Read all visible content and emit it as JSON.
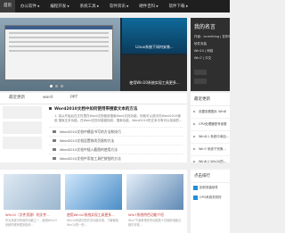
{
  "nav": {
    "home": "首页",
    "items": [
      {
        "label": "办公软件"
      },
      {
        "label": "编程开发"
      },
      {
        "label": "系统工具"
      },
      {
        "label": "软件资讯"
      },
      {
        "label": "硬件百科"
      },
      {
        "label": "软件下载"
      }
    ]
  },
  "slider": {
    "slide_b_caption": "Linux系统下如何安装...",
    "slide_c_caption": "使用Win10系统实现工具更多..."
  },
  "sitebox": {
    "title": "我的名言",
    "lines": [
      "作者：ecmrlbing | 发布时间",
      "软件安装",
      "Win10 | 网络",
      "Win7 | 中文"
    ],
    "mini1": "",
    "mini2": ""
  },
  "tabs": [
    "最近更新",
    "word",
    "PPT"
  ],
  "articles": {
    "headline": "Word2010文档中如何使用带搜索文本的方法",
    "desc": "1. 将从开始后在文件里在Word文档使用搜索Word文档功能，你就可以选中在Word2010使用 搜索文本功能，在Word文档可能被找到，搜索功能，Word2010的文本中有可以找到的...",
    "items": [
      "Word2010文档中横竖书写的方法和技巧",
      "Word2013文档设置修改页眉的方法",
      "Word2010文档中插入截图的使用方法",
      "Word2010文档中添加工具栏按钮的方法"
    ]
  },
  "sidelist": {
    "head": "最近更新",
    "entries": [
      "设置查看图片 Win8",
      "CPU处理器型号参数",
      "Win8.1 系统中添加...",
      "Win7 系统下完美...",
      "Win8.1 Win10的..."
    ]
  },
  "cards": [
    {
      "title": "Win10（文件资源）的文件...",
      "text": "作为系统中有用的功能之一，使用Win10系统时候有很多操作..."
    },
    {
      "title": "使用Win10系统实现工具更多...",
      "text": "Win10系统中的共享功能可用，了解使用Win10的一些..."
    },
    {
      "title": "Win7系统特色功能介绍",
      "text": "Win7下面有很多的功能是人们使用电脑过程中非常..."
    }
  ],
  "sidebottom": {
    "head": "点击排行",
    "entries": [
      "如何安装软件",
      "CPU系统关机时"
    ]
  }
}
